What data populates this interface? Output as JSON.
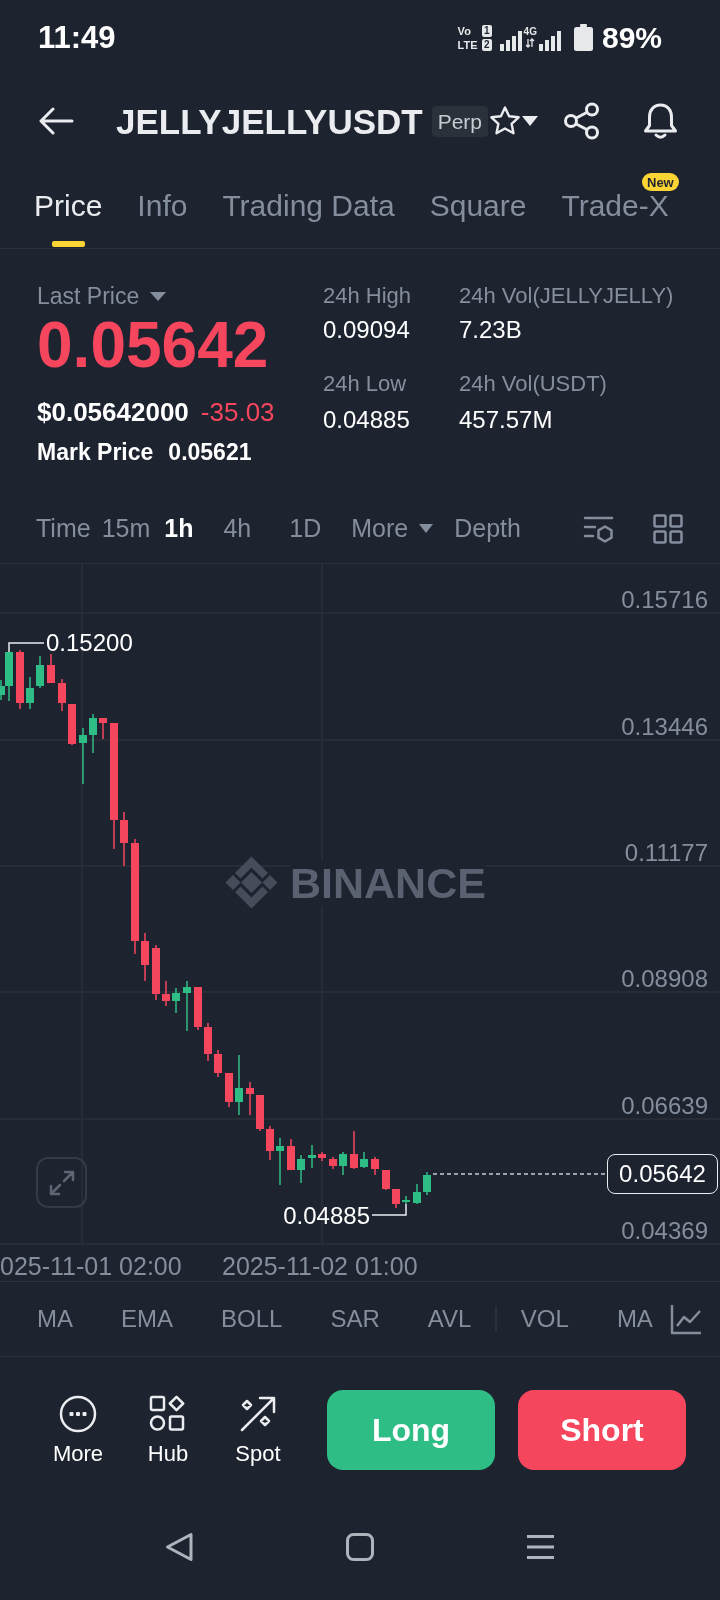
{
  "status_bar": {
    "time": "11:49",
    "volte": [
      {
        "label": "Vo",
        "sim": "1"
      },
      {
        "label": "LTE",
        "sim": "2"
      }
    ],
    "network_type": "4G",
    "battery": "89%"
  },
  "header": {
    "title": "JELLYJELLYUSDT",
    "badge": "Perp",
    "favorite": false
  },
  "tabs": [
    {
      "label": "Price",
      "selected": true
    },
    {
      "label": "Info",
      "selected": false
    },
    {
      "label": "Trading Data",
      "selected": false
    },
    {
      "label": "Square",
      "selected": false
    },
    {
      "label": "Trade-X",
      "selected": false,
      "badge": "New"
    }
  ],
  "ticker": {
    "last_price_label": "Last Price",
    "last_price": "0.05642",
    "falling": true,
    "usd_price": "$0.05642000",
    "change": "-35.03",
    "mark_price_label": "Mark Price",
    "mark_price": "0.05621",
    "stats": [
      {
        "label": "24h High",
        "value": "0.09094"
      },
      {
        "label": "24h Low",
        "value": "0.04885"
      },
      {
        "label": "24h Vol(JELLYJELLY)",
        "value": "7.23B"
      },
      {
        "label": "24h Vol(USDT)",
        "value": "457.57M"
      }
    ]
  },
  "intervals": {
    "options": [
      {
        "label": "Time",
        "selected": false
      },
      {
        "label": "15m",
        "selected": false
      },
      {
        "label": "1h",
        "selected": true
      },
      {
        "label": "4h",
        "selected": false
      },
      {
        "label": "1D",
        "selected": false
      }
    ],
    "more": "More",
    "depth": "Depth"
  },
  "chart": {
    "y_axis": [
      "0.15716",
      "0.13446",
      "0.11177",
      "0.08908",
      "0.06639",
      "0.04369"
    ],
    "x_axis": [
      "025-11-01 02:00",
      "2025-11-02 01:00"
    ],
    "high_label": "0.15200",
    "low_label": "0.04885",
    "current_price": "0.05642",
    "brand": "BINANCE"
  },
  "indicators": {
    "main": [
      "MA",
      "EMA",
      "BOLL",
      "SAR",
      "AVL"
    ],
    "sub": [
      "VOL",
      "MA"
    ]
  },
  "actions": [
    "More",
    "Hub",
    "Spot"
  ],
  "trade_buttons": [
    {
      "label": "Long",
      "kind": "long"
    },
    {
      "label": "Short",
      "kind": "short"
    }
  ]
}
